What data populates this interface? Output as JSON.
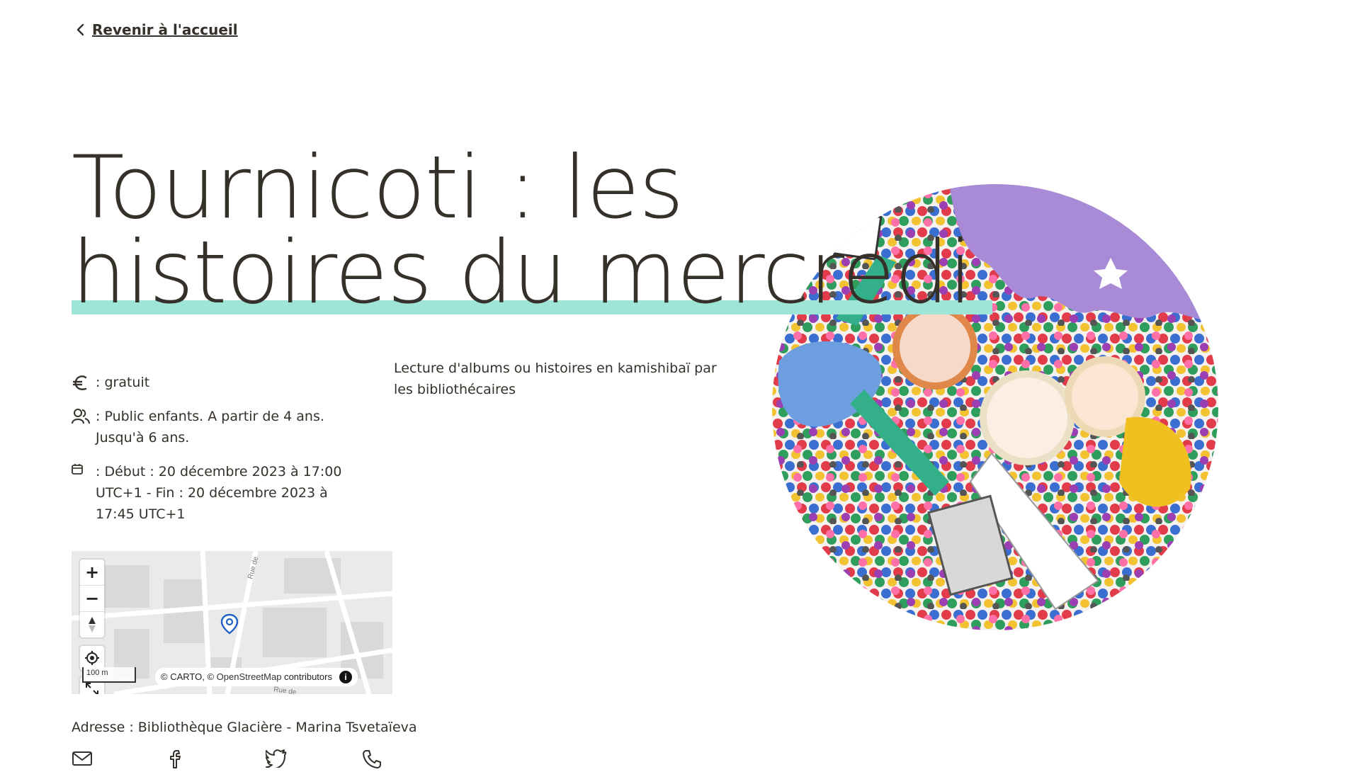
{
  "nav": {
    "back_label": "Revenir à l'accueil"
  },
  "event": {
    "title": "Tournicoti : les histoires du mercredi",
    "description": "Lecture d'albums ou histoires en kamishibaï par les bibliothécaires",
    "price": ": gratuit",
    "audience": ": Public enfants. A partir de 4 ans. Jusqu'à 6 ans.",
    "dates": ": Début : 20 décembre 2023 à 17:00 UTC+1 - Fin : 20 décembre 2023 à 17:45 UTC+1",
    "address": "Adresse : Bibliothèque Glacière - Marina Tsvetaïeva"
  },
  "map": {
    "zoom_in": "+",
    "zoom_out": "−",
    "scale": "100 m",
    "attribution_prefix": "© CARTO, ©",
    "attribution_osm": "OpenStreetMap",
    "attribution_suffix": "contributors",
    "info": "i",
    "street_1": "Rue de",
    "street_2": "Rue de"
  },
  "icons": {
    "price": "euro-icon",
    "audience": "people-icon",
    "dates": "calendar-icon",
    "share": [
      "mail-icon",
      "facebook-icon",
      "twitter-icon",
      "phone-icon"
    ]
  },
  "colors": {
    "text": "#35312a",
    "accent_underline": "#9ee4d7",
    "marker": "#1f62c4"
  }
}
